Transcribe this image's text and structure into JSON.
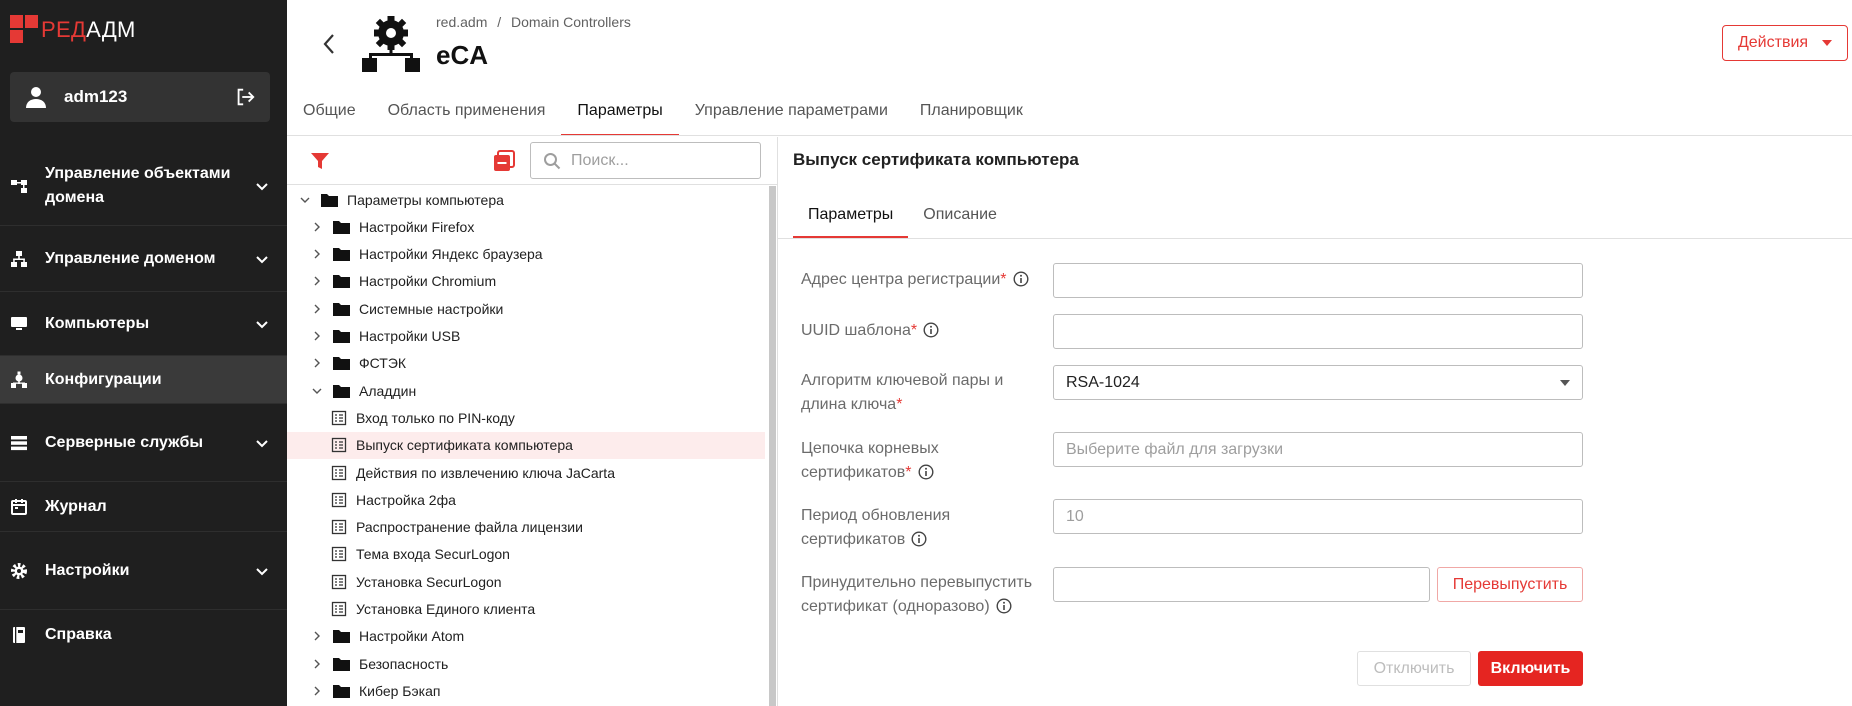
{
  "logo": {
    "part1": "РЕД",
    "part2": "АДМ"
  },
  "user": {
    "name": "adm123"
  },
  "nav": [
    {
      "label": "Управление объектами домена",
      "icon": "hierarchy-icon",
      "expandable": true
    },
    {
      "label": "Управление доменом",
      "icon": "sitemap-icon",
      "expandable": true
    },
    {
      "label": "Компьютеры",
      "icon": "monitor-icon",
      "expandable": true
    },
    {
      "label": "Конфигурации",
      "icon": "config-icon",
      "expandable": false,
      "active": true
    },
    {
      "label": "Серверные службы",
      "icon": "server-icon",
      "expandable": true
    },
    {
      "label": "Журнал",
      "icon": "calendar-icon",
      "expandable": false
    },
    {
      "label": "Настройки",
      "icon": "gear-icon",
      "expandable": true
    },
    {
      "label": "Справка",
      "icon": "book-icon",
      "expandable": false
    }
  ],
  "header": {
    "breadcrumb": [
      "red.adm",
      "/",
      "Domain Controllers"
    ],
    "title": "eCA",
    "actions_label": "Действия"
  },
  "tabs": [
    {
      "label": "Общие"
    },
    {
      "label": "Область применения"
    },
    {
      "label": "Параметры",
      "active": true
    },
    {
      "label": "Управление параметрами"
    },
    {
      "label": "Планировщик"
    }
  ],
  "tree_toolbar": {
    "search_placeholder": "Поиск..."
  },
  "tree": [
    {
      "label": "Параметры компьютера",
      "type": "folder",
      "level": 0,
      "state": "expanded"
    },
    {
      "label": "Настройки Firefox",
      "type": "folder",
      "level": 1,
      "state": "collapsed"
    },
    {
      "label": "Настройки Яндекс браузера",
      "type": "folder",
      "level": 1,
      "state": "collapsed"
    },
    {
      "label": "Настройки Chromium",
      "type": "folder",
      "level": 1,
      "state": "collapsed"
    },
    {
      "label": "Системные настройки",
      "type": "folder",
      "level": 1,
      "state": "collapsed"
    },
    {
      "label": "Настройки USB",
      "type": "folder",
      "level": 1,
      "state": "collapsed"
    },
    {
      "label": "ФСТЭК",
      "type": "folder",
      "level": 1,
      "state": "collapsed"
    },
    {
      "label": "Аладдин",
      "type": "folder",
      "level": 1,
      "state": "expanded"
    },
    {
      "label": "Вход только по PIN-коду",
      "type": "item",
      "level": 2
    },
    {
      "label": "Выпуск сертификата компьютера",
      "type": "item",
      "level": 2,
      "selected": true
    },
    {
      "label": "Действия по извлечению ключа JaCarta",
      "type": "item",
      "level": 2
    },
    {
      "label": "Настройка 2фа",
      "type": "item",
      "level": 2
    },
    {
      "label": "Распространение файла лицензии",
      "type": "item",
      "level": 2
    },
    {
      "label": "Тема входа SecurLogon",
      "type": "item",
      "level": 2
    },
    {
      "label": "Установка SecurLogon",
      "type": "item",
      "level": 2
    },
    {
      "label": "Установка Единого клиента",
      "type": "item",
      "level": 2
    },
    {
      "label": "Настройки Atom",
      "type": "folder",
      "level": 1,
      "state": "collapsed"
    },
    {
      "label": "Безопасность",
      "type": "folder",
      "level": 1,
      "state": "collapsed"
    },
    {
      "label": "Кибер Бэкап",
      "type": "folder",
      "level": 1,
      "state": "collapsed"
    }
  ],
  "form": {
    "title": "Выпуск сертификата компьютера",
    "subtabs": [
      {
        "label": "Параметры",
        "active": true
      },
      {
        "label": "Описание"
      }
    ],
    "fields": {
      "ca_address": {
        "label": "Адрес центра регистрации",
        "required": "*",
        "value": ""
      },
      "template_uuid": {
        "label": "UUID шаблона",
        "required": "*",
        "value": ""
      },
      "key_algorithm": {
        "label_line1": "Алгоритм ключевой пары и",
        "label_line2": "длина ключа",
        "required": "*",
        "value": "RSA-1024"
      },
      "root_chain": {
        "label_line1": "Цепочка корневых",
        "label_line2": "сертификатов",
        "required": "*",
        "placeholder": "Выберите файл для загрузки"
      },
      "refresh_period": {
        "label_line1": "Период обновления",
        "label_line2": "сертификатов",
        "value": "10"
      },
      "force_reissue": {
        "label_line1": "Принудительно перевыпустить",
        "label_line2": "сертификат (одноразово)",
        "value": "",
        "button_label": "Перевыпустить"
      }
    },
    "disable_label": "Отключить",
    "enable_label": "Включить"
  },
  "colors": {
    "accent": "#e53935",
    "sidebar": "#1f1f1f",
    "selected_row": "#fdecec"
  }
}
